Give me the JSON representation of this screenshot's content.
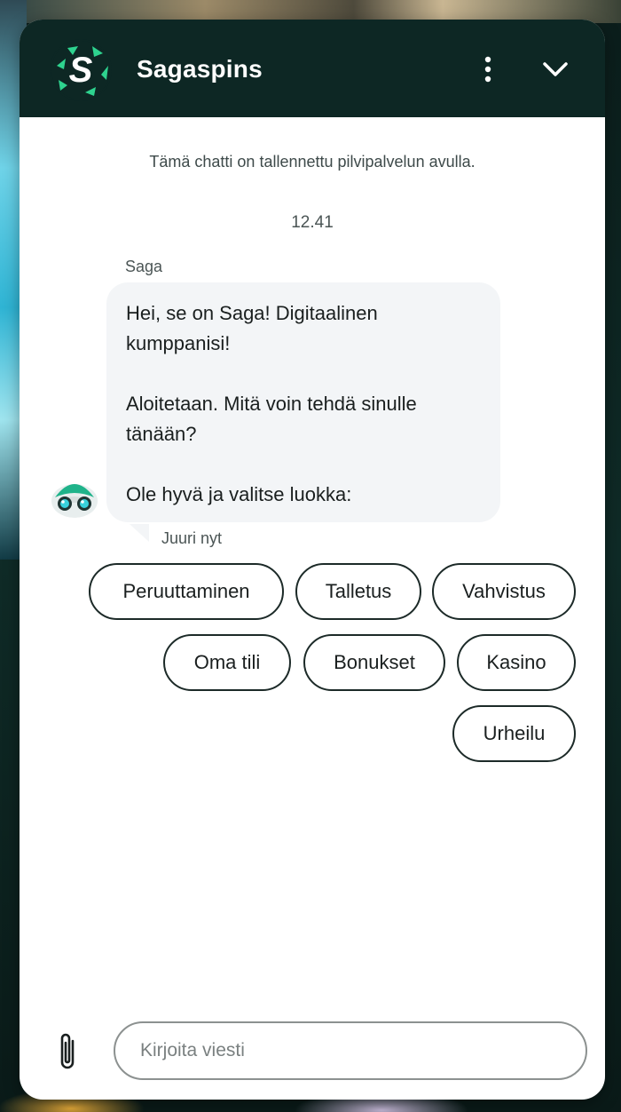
{
  "colors": {
    "header_bg": "#0d2724",
    "brand_green": "#2ed38f",
    "bubble_bg": "#f3f5f7",
    "chip_border": "#1c2a28"
  },
  "header": {
    "title": "Sagaspins",
    "logo_letter": "S",
    "menu_icon": "more-vertical-icon",
    "collapse_icon": "chevron-down-icon"
  },
  "chat": {
    "notice": "Tämä chatti on tallennettu pilvipalvelun avulla.",
    "timestamp": "12.41",
    "message": {
      "sender": "Saga",
      "paragraphs": [
        "Hei, se on Saga! Digitaalinen kumppanisi!",
        "Aloitetaan. Mitä voin tehdä sinulle tänään?",
        "Ole hyvä ja valitse luokka:"
      ],
      "status": "Juuri nyt",
      "avatar_icon": "bot-avatar-icon"
    },
    "quick_replies": [
      "Peruuttaminen",
      "Talletus",
      "Vahvistus",
      "Oma tili",
      "Bonukset",
      "Kasino",
      "Urheilu"
    ]
  },
  "composer": {
    "placeholder": "Kirjoita viesti",
    "value": "",
    "attach_icon": "paperclip-icon"
  }
}
